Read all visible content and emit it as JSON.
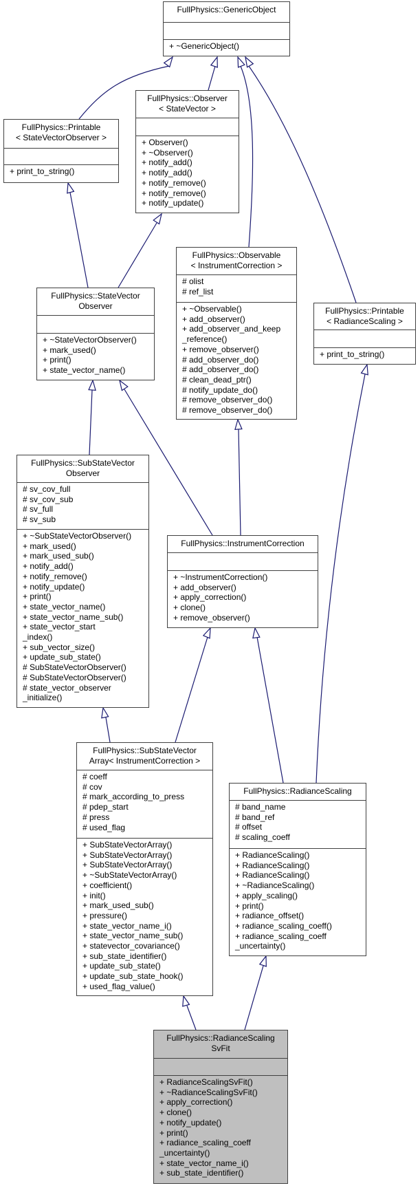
{
  "diagram": {
    "type": "uml-class-inheritance",
    "classes": {
      "generic_object": {
        "title": [
          "FullPhysics::GenericObject"
        ],
        "attributes": [],
        "methods": [
          "+ ~GenericObject()"
        ]
      },
      "printable_svo": {
        "title": [
          "FullPhysics::Printable",
          "< StateVectorObserver >"
        ],
        "attributes": [],
        "methods": [
          "+ print_to_string()"
        ]
      },
      "observer_sv": {
        "title": [
          "FullPhysics::Observer",
          "< StateVector >"
        ],
        "attributes": [],
        "methods": [
          "+ Observer()",
          "+ ~Observer()",
          "+ notify_add()",
          "+ notify_add()",
          "+ notify_remove()",
          "+ notify_remove()",
          "+ notify_update()"
        ]
      },
      "state_vector_observer": {
        "title": [
          "FullPhysics::StateVector",
          "Observer"
        ],
        "attributes": [],
        "methods": [
          "+ ~StateVectorObserver()",
          "+ mark_used()",
          "+ print()",
          "+ state_vector_name()"
        ]
      },
      "observable_ic": {
        "title": [
          "FullPhysics::Observable",
          "< InstrumentCorrection >"
        ],
        "attributes": [
          "# olist",
          "# ref_list"
        ],
        "methods": [
          "+ ~Observable()",
          "+ add_observer()",
          "+ add_observer_and_keep",
          "_reference()",
          "+ remove_observer()",
          "# add_observer_do()",
          "# add_observer_do()",
          "# clean_dead_ptr()",
          "# notify_update_do()",
          "# remove_observer_do()",
          "# remove_observer_do()"
        ]
      },
      "printable_rs": {
        "title": [
          "FullPhysics::Printable",
          "< RadianceScaling >"
        ],
        "attributes": [],
        "methods": [
          "+ print_to_string()"
        ]
      },
      "sub_state_vector_observer": {
        "title": [
          "FullPhysics::SubStateVector",
          "Observer"
        ],
        "attributes": [
          "# sv_cov_full",
          "# sv_cov_sub",
          "# sv_full",
          "# sv_sub"
        ],
        "methods": [
          "+ ~SubStateVectorObserver()",
          "+ mark_used()",
          "+ mark_used_sub()",
          "+ notify_add()",
          "+ notify_remove()",
          "+ notify_update()",
          "+ print()",
          "+ state_vector_name()",
          "+ state_vector_name_sub()",
          "+ state_vector_start",
          "_index()",
          "+ sub_vector_size()",
          "+ update_sub_state()",
          "# SubStateVectorObserver()",
          "# SubStateVectorObserver()",
          "# state_vector_observer",
          "_initialize()"
        ]
      },
      "instrument_correction": {
        "title": [
          "FullPhysics::InstrumentCorrection"
        ],
        "attributes": [],
        "methods": [
          "+ ~InstrumentCorrection()",
          "+ add_observer()",
          "+ apply_correction()",
          "+ clone()",
          "+ remove_observer()"
        ]
      },
      "sub_state_vector_array": {
        "title": [
          "FullPhysics::SubStateVector",
          "Array< InstrumentCorrection >"
        ],
        "attributes": [
          "# coeff",
          "# cov",
          "# mark_according_to_press",
          "# pdep_start",
          "# press",
          "# used_flag"
        ],
        "methods": [
          "+ SubStateVectorArray()",
          "+ SubStateVectorArray()",
          "+ SubStateVectorArray()",
          "+ ~SubStateVectorArray()",
          "+ coefficient()",
          "+ init()",
          "+ mark_used_sub()",
          "+ pressure()",
          "+ state_vector_name_i()",
          "+ state_vector_name_sub()",
          "+ statevector_covariance()",
          "+ sub_state_identifier()",
          "+ update_sub_state()",
          "+ update_sub_state_hook()",
          "+ used_flag_value()"
        ]
      },
      "radiance_scaling": {
        "title": [
          "FullPhysics::RadianceScaling"
        ],
        "attributes": [
          "# band_name",
          "# band_ref",
          "# offset",
          "# scaling_coeff"
        ],
        "methods": [
          "+ RadianceScaling()",
          "+ RadianceScaling()",
          "+ RadianceScaling()",
          "+ ~RadianceScaling()",
          "+ apply_scaling()",
          "+ print()",
          "+ radiance_offset()",
          "+ radiance_scaling_coeff()",
          "+ radiance_scaling_coeff",
          "_uncertainty()"
        ]
      },
      "radiance_scaling_sv_fit": {
        "title": [
          "FullPhysics::RadianceScaling",
          "SvFit"
        ],
        "attributes": [],
        "methods": [
          "+ RadianceScalingSvFit()",
          "+ ~RadianceScalingSvFit()",
          "+ apply_correction()",
          "+ clone()",
          "+ notify_update()",
          "+ print()",
          "+ radiance_scaling_coeff",
          "_uncertainty()",
          "+ state_vector_name_i()",
          "+ sub_state_identifier()"
        ]
      }
    },
    "inheritance": [
      {
        "child": "printable_svo",
        "parent": "generic_object"
      },
      {
        "child": "observer_sv",
        "parent": "generic_object"
      },
      {
        "child": "observable_ic",
        "parent": "generic_object"
      },
      {
        "child": "printable_rs",
        "parent": "generic_object"
      },
      {
        "child": "state_vector_observer",
        "parent": "printable_svo"
      },
      {
        "child": "state_vector_observer",
        "parent": "observer_sv"
      },
      {
        "child": "sub_state_vector_observer",
        "parent": "state_vector_observer"
      },
      {
        "child": "instrument_correction",
        "parent": "state_vector_observer"
      },
      {
        "child": "instrument_correction",
        "parent": "observable_ic"
      },
      {
        "child": "sub_state_vector_array",
        "parent": "sub_state_vector_observer"
      },
      {
        "child": "sub_state_vector_array",
        "parent": "instrument_correction"
      },
      {
        "child": "radiance_scaling",
        "parent": "instrument_correction"
      },
      {
        "child": "radiance_scaling",
        "parent": "printable_rs"
      },
      {
        "child": "radiance_scaling_sv_fit",
        "parent": "sub_state_vector_array"
      },
      {
        "child": "radiance_scaling_sv_fit",
        "parent": "radiance_scaling"
      }
    ],
    "colors": {
      "edge": "#191970",
      "border": "#404040",
      "focus_fill": "#bfbfbf",
      "box_fill": "#ffffff"
    }
  }
}
